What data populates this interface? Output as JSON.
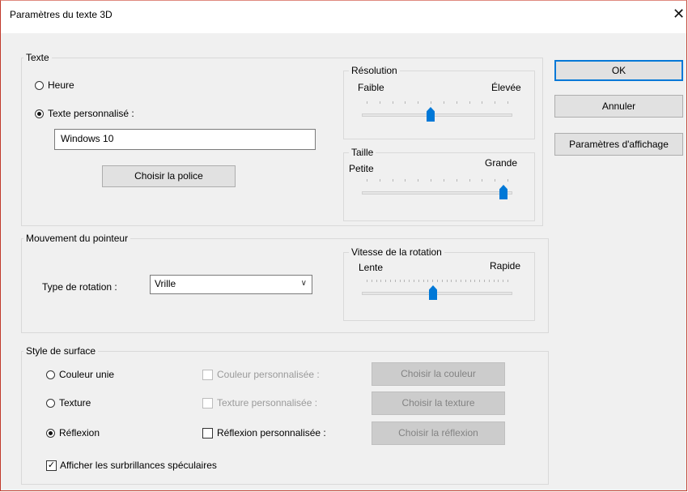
{
  "dialog": {
    "title": "Paramètres du texte 3D",
    "close_icon": "close-icon"
  },
  "text_group": {
    "label": "Texte",
    "radio_time": "Heure",
    "radio_custom": "Texte personnalisé :",
    "text_value": "Windows 10",
    "choose_font": "Choisir la police"
  },
  "resolution": {
    "label": "Résolution",
    "low": "Faible",
    "high": "Élevée",
    "value_fraction": 0.45
  },
  "size": {
    "label": "Taille",
    "low": "Petite",
    "high": "Grande",
    "value_fraction": 1.0
  },
  "pointer_group": {
    "label": "Mouvement du pointeur",
    "rotation_type_label": "Type de rotation :",
    "rotation_type_value": "Vrille"
  },
  "rotation_speed": {
    "label": "Vitesse de la rotation",
    "low": "Lente",
    "high": "Rapide",
    "value_fraction": 0.47
  },
  "surface_group": {
    "label": "Style de surface",
    "solid_color": "Couleur unie",
    "texture": "Texture",
    "reflection": "Réflexion",
    "custom_color": "Couleur personnalisée :",
    "custom_texture": "Texture personnalisée :",
    "custom_reflection": "Réflexion personnalisée :",
    "choose_color": "Choisir la couleur",
    "choose_texture": "Choisir la texture",
    "choose_reflection": "Choisir la réflexion",
    "specular": "Afficher les surbrillances spéculaires"
  },
  "buttons": {
    "ok": "OK",
    "cancel": "Annuler",
    "display_settings": "Paramètres d'affichage"
  },
  "colors": {
    "accent": "#0078d7",
    "window_border": "#c0392b"
  }
}
